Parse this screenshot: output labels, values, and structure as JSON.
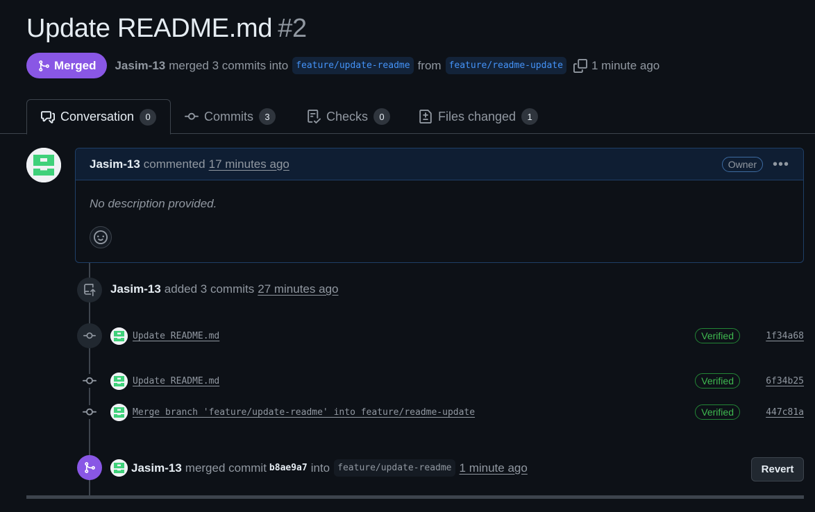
{
  "pr": {
    "title": "Update README.md",
    "number": "#2",
    "state": "Merged",
    "author": "Jasim-13",
    "merge_text": "merged 3 commits into",
    "base_branch": "feature/update-readme",
    "from_text": "from",
    "head_branch": "feature/readme-update",
    "time": "1 minute ago"
  },
  "tabs": [
    {
      "label": "Conversation",
      "count": "0"
    },
    {
      "label": "Commits",
      "count": "3"
    },
    {
      "label": "Checks",
      "count": "0"
    },
    {
      "label": "Files changed",
      "count": "1"
    }
  ],
  "comment": {
    "author": "Jasim-13",
    "action": "commented",
    "time": "17 minutes ago",
    "role": "Owner",
    "body": "No description provided."
  },
  "commits_event": {
    "author": "Jasim-13",
    "action": "added 3 commits",
    "time": "27 minutes ago"
  },
  "commits": [
    {
      "message": "Update README.md",
      "verified": "Verified",
      "sha": "1f34a68"
    },
    {
      "message": "Update README.md",
      "verified": "Verified",
      "sha": "6f34b25"
    },
    {
      "message": "Merge branch 'feature/update-readme' into feature/readme-update",
      "verified": "Verified",
      "sha": "447c81a"
    }
  ],
  "merge_event": {
    "author": "Jasim-13",
    "action": "merged commit",
    "sha": "b8ae9a7",
    "into": "into",
    "branch": "feature/update-readme",
    "time": "1 minute ago",
    "revert_label": "Revert"
  },
  "colors": {
    "background": "#0d1117",
    "merged": "#8957e5",
    "link": "#4493f8",
    "verified": "#3fb950"
  },
  "icons": {
    "state": "git-merge-icon",
    "copy": "copy-icon",
    "tab_conversation": "comment-discussion-icon",
    "tab_commits": "git-commit-icon",
    "tab_checks": "checklist-icon",
    "tab_files": "file-diff-icon",
    "reaction": "smiley-icon",
    "push": "repo-push-icon"
  }
}
